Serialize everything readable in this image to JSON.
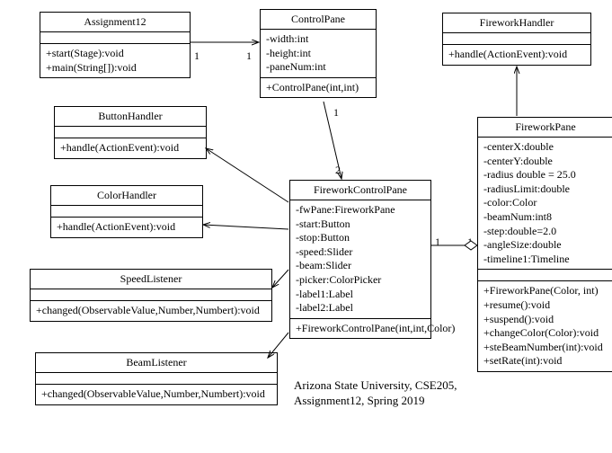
{
  "classes": {
    "assignment12": {
      "name": "Assignment12",
      "methods": [
        "+start(Stage):void",
        "+main(String[]):void"
      ]
    },
    "controlPane": {
      "name": "ControlPane",
      "attrs": [
        "-width:int",
        "-height:int",
        "-paneNum:int"
      ],
      "methods": [
        "+ControlPane(int,int)"
      ]
    },
    "fireworkHandler": {
      "name": "FireworkHandler",
      "methods": [
        "+handle(ActionEvent):void"
      ]
    },
    "buttonHandler": {
      "name": "ButtonHandler",
      "methods": [
        "+handle(ActionEvent):void"
      ]
    },
    "colorHandler": {
      "name": "ColorHandler",
      "methods": [
        "+handle(ActionEvent):void"
      ]
    },
    "speedListener": {
      "name": "SpeedListener",
      "methods": [
        "+changed(ObservableValue,Number,Numbert):void"
      ]
    },
    "beamListener": {
      "name": "BeamListener",
      "methods": [
        "+changed(ObservableValue,Number,Numbert):void"
      ]
    },
    "fireworkControlPane": {
      "name": "FireworkControlPane",
      "attrs": [
        "-fwPane:FireworkPane",
        "-start:Button",
        "-stop:Button",
        "-speed:Slider",
        "-beam:Slider",
        "-picker:ColorPicker",
        "-label1:Label",
        "-label2:Label"
      ],
      "methods": [
        "+FireworkControlPane(int,int,Color)"
      ]
    },
    "fireworkPane": {
      "name": "FireworkPane",
      "attrs": [
        "-centerX:double",
        "-centerY:double",
        "-radius double = 25.0",
        "-radiusLimit:double",
        "-color:Color",
        "-beamNum:int8",
        "-step:double=2.0",
        "-angleSize:double",
        "-timeline1:Timeline"
      ],
      "methods": [
        "+FireworkPane(Color, int)",
        "+resume():void",
        "+suspend():void",
        "+changeColor(Color):void",
        "+steBeamNumber(int):void",
        "+setRate(int):void"
      ]
    }
  },
  "multiplicities": {
    "a12_cp_left": "1",
    "a12_cp_right": "1",
    "cp_fcp_top": "1",
    "cp_fcp_bottom": "2",
    "fcp_fp_left": "1",
    "fcp_fp_right": "1"
  },
  "caption": {
    "line1": "Arizona State University, CSE205,",
    "line2": "Assignment12, Spring 2019"
  }
}
